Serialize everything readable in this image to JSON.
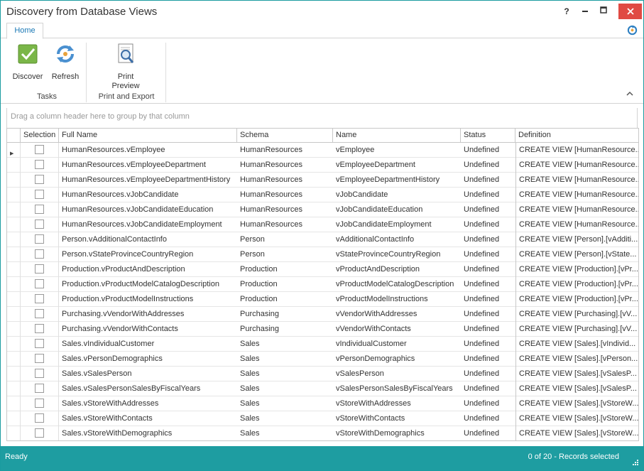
{
  "window": {
    "title": "Discovery from Database Views",
    "help_label": "?",
    "minimize_label": "▬",
    "maximize_label": "□",
    "close_label": "✕"
  },
  "ribbon": {
    "tab_home": "Home",
    "discover_label": "Discover",
    "refresh_label": "Refresh",
    "print_preview_label": "Print\nPreview",
    "group_tasks": "Tasks",
    "group_print_export": "Print and Export",
    "collapse_label": "⌃"
  },
  "grid": {
    "group_panel_text": "Drag a column header here to group by that column",
    "columns": [
      "Selection",
      "Full Name",
      "Schema",
      "Name",
      "Status",
      "Definition"
    ],
    "rows": [
      {
        "full_name": "HumanResources.vEmployee",
        "schema": "HumanResources",
        "name": "vEmployee",
        "status": "Undefined",
        "definition": "CREATE VIEW [HumanResource..."
      },
      {
        "full_name": "HumanResources.vEmployeeDepartment",
        "schema": "HumanResources",
        "name": "vEmployeeDepartment",
        "status": "Undefined",
        "definition": "CREATE VIEW [HumanResource..."
      },
      {
        "full_name": "HumanResources.vEmployeeDepartmentHistory",
        "schema": "HumanResources",
        "name": "vEmployeeDepartmentHistory",
        "status": "Undefined",
        "definition": "CREATE VIEW [HumanResource..."
      },
      {
        "full_name": "HumanResources.vJobCandidate",
        "schema": "HumanResources",
        "name": "vJobCandidate",
        "status": "Undefined",
        "definition": "CREATE VIEW [HumanResource..."
      },
      {
        "full_name": "HumanResources.vJobCandidateEducation",
        "schema": "HumanResources",
        "name": "vJobCandidateEducation",
        "status": "Undefined",
        "definition": "CREATE VIEW [HumanResource..."
      },
      {
        "full_name": "HumanResources.vJobCandidateEmployment",
        "schema": "HumanResources",
        "name": "vJobCandidateEmployment",
        "status": "Undefined",
        "definition": "CREATE VIEW [HumanResource..."
      },
      {
        "full_name": "Person.vAdditionalContactInfo",
        "schema": "Person",
        "name": "vAdditionalContactInfo",
        "status": "Undefined",
        "definition": "CREATE VIEW [Person].[vAdditi..."
      },
      {
        "full_name": "Person.vStateProvinceCountryRegion",
        "schema": "Person",
        "name": "vStateProvinceCountryRegion",
        "status": "Undefined",
        "definition": "CREATE VIEW [Person].[vState..."
      },
      {
        "full_name": "Production.vProductAndDescription",
        "schema": "Production",
        "name": "vProductAndDescription",
        "status": "Undefined",
        "definition": "CREATE VIEW [Production].[vPr..."
      },
      {
        "full_name": "Production.vProductModelCatalogDescription",
        "schema": "Production",
        "name": "vProductModelCatalogDescription",
        "status": "Undefined",
        "definition": "CREATE VIEW [Production].[vPr..."
      },
      {
        "full_name": "Production.vProductModelInstructions",
        "schema": "Production",
        "name": "vProductModelInstructions",
        "status": "Undefined",
        "definition": "CREATE VIEW [Production].[vPr..."
      },
      {
        "full_name": "Purchasing.vVendorWithAddresses",
        "schema": "Purchasing",
        "name": "vVendorWithAddresses",
        "status": "Undefined",
        "definition": "CREATE VIEW [Purchasing].[vV..."
      },
      {
        "full_name": "Purchasing.vVendorWithContacts",
        "schema": "Purchasing",
        "name": "vVendorWithContacts",
        "status": "Undefined",
        "definition": "CREATE VIEW [Purchasing].[vV..."
      },
      {
        "full_name": "Sales.vIndividualCustomer",
        "schema": "Sales",
        "name": "vIndividualCustomer",
        "status": "Undefined",
        "definition": "CREATE VIEW [Sales].[vIndivid..."
      },
      {
        "full_name": "Sales.vPersonDemographics",
        "schema": "Sales",
        "name": "vPersonDemographics",
        "status": "Undefined",
        "definition": "CREATE VIEW [Sales].[vPerson..."
      },
      {
        "full_name": "Sales.vSalesPerson",
        "schema": "Sales",
        "name": "vSalesPerson",
        "status": "Undefined",
        "definition": "CREATE VIEW [Sales].[vSalesP..."
      },
      {
        "full_name": "Sales.vSalesPersonSalesByFiscalYears",
        "schema": "Sales",
        "name": "vSalesPersonSalesByFiscalYears",
        "status": "Undefined",
        "definition": "CREATE VIEW [Sales].[vSalesP..."
      },
      {
        "full_name": "Sales.vStoreWithAddresses",
        "schema": "Sales",
        "name": "vStoreWithAddresses",
        "status": "Undefined",
        "definition": "CREATE VIEW [Sales].[vStoreW..."
      },
      {
        "full_name": "Sales.vStoreWithContacts",
        "schema": "Sales",
        "name": "vStoreWithContacts",
        "status": "Undefined",
        "definition": "CREATE VIEW [Sales].[vStoreW..."
      },
      {
        "full_name": "Sales.vStoreWithDemographics",
        "schema": "Sales",
        "name": "vStoreWithDemographics",
        "status": "Undefined",
        "definition": "CREATE VIEW [Sales].[vStoreW..."
      }
    ]
  },
  "status": {
    "left": "Ready",
    "right": "0 of 20 - Records selected"
  },
  "colors": {
    "accent": "#1e9da1",
    "close": "#e04a43",
    "tab_text": "#1a78b5"
  },
  "icons": {
    "discover": "checkmark-icon",
    "refresh": "refresh-icon",
    "print_preview": "print-preview-icon"
  }
}
